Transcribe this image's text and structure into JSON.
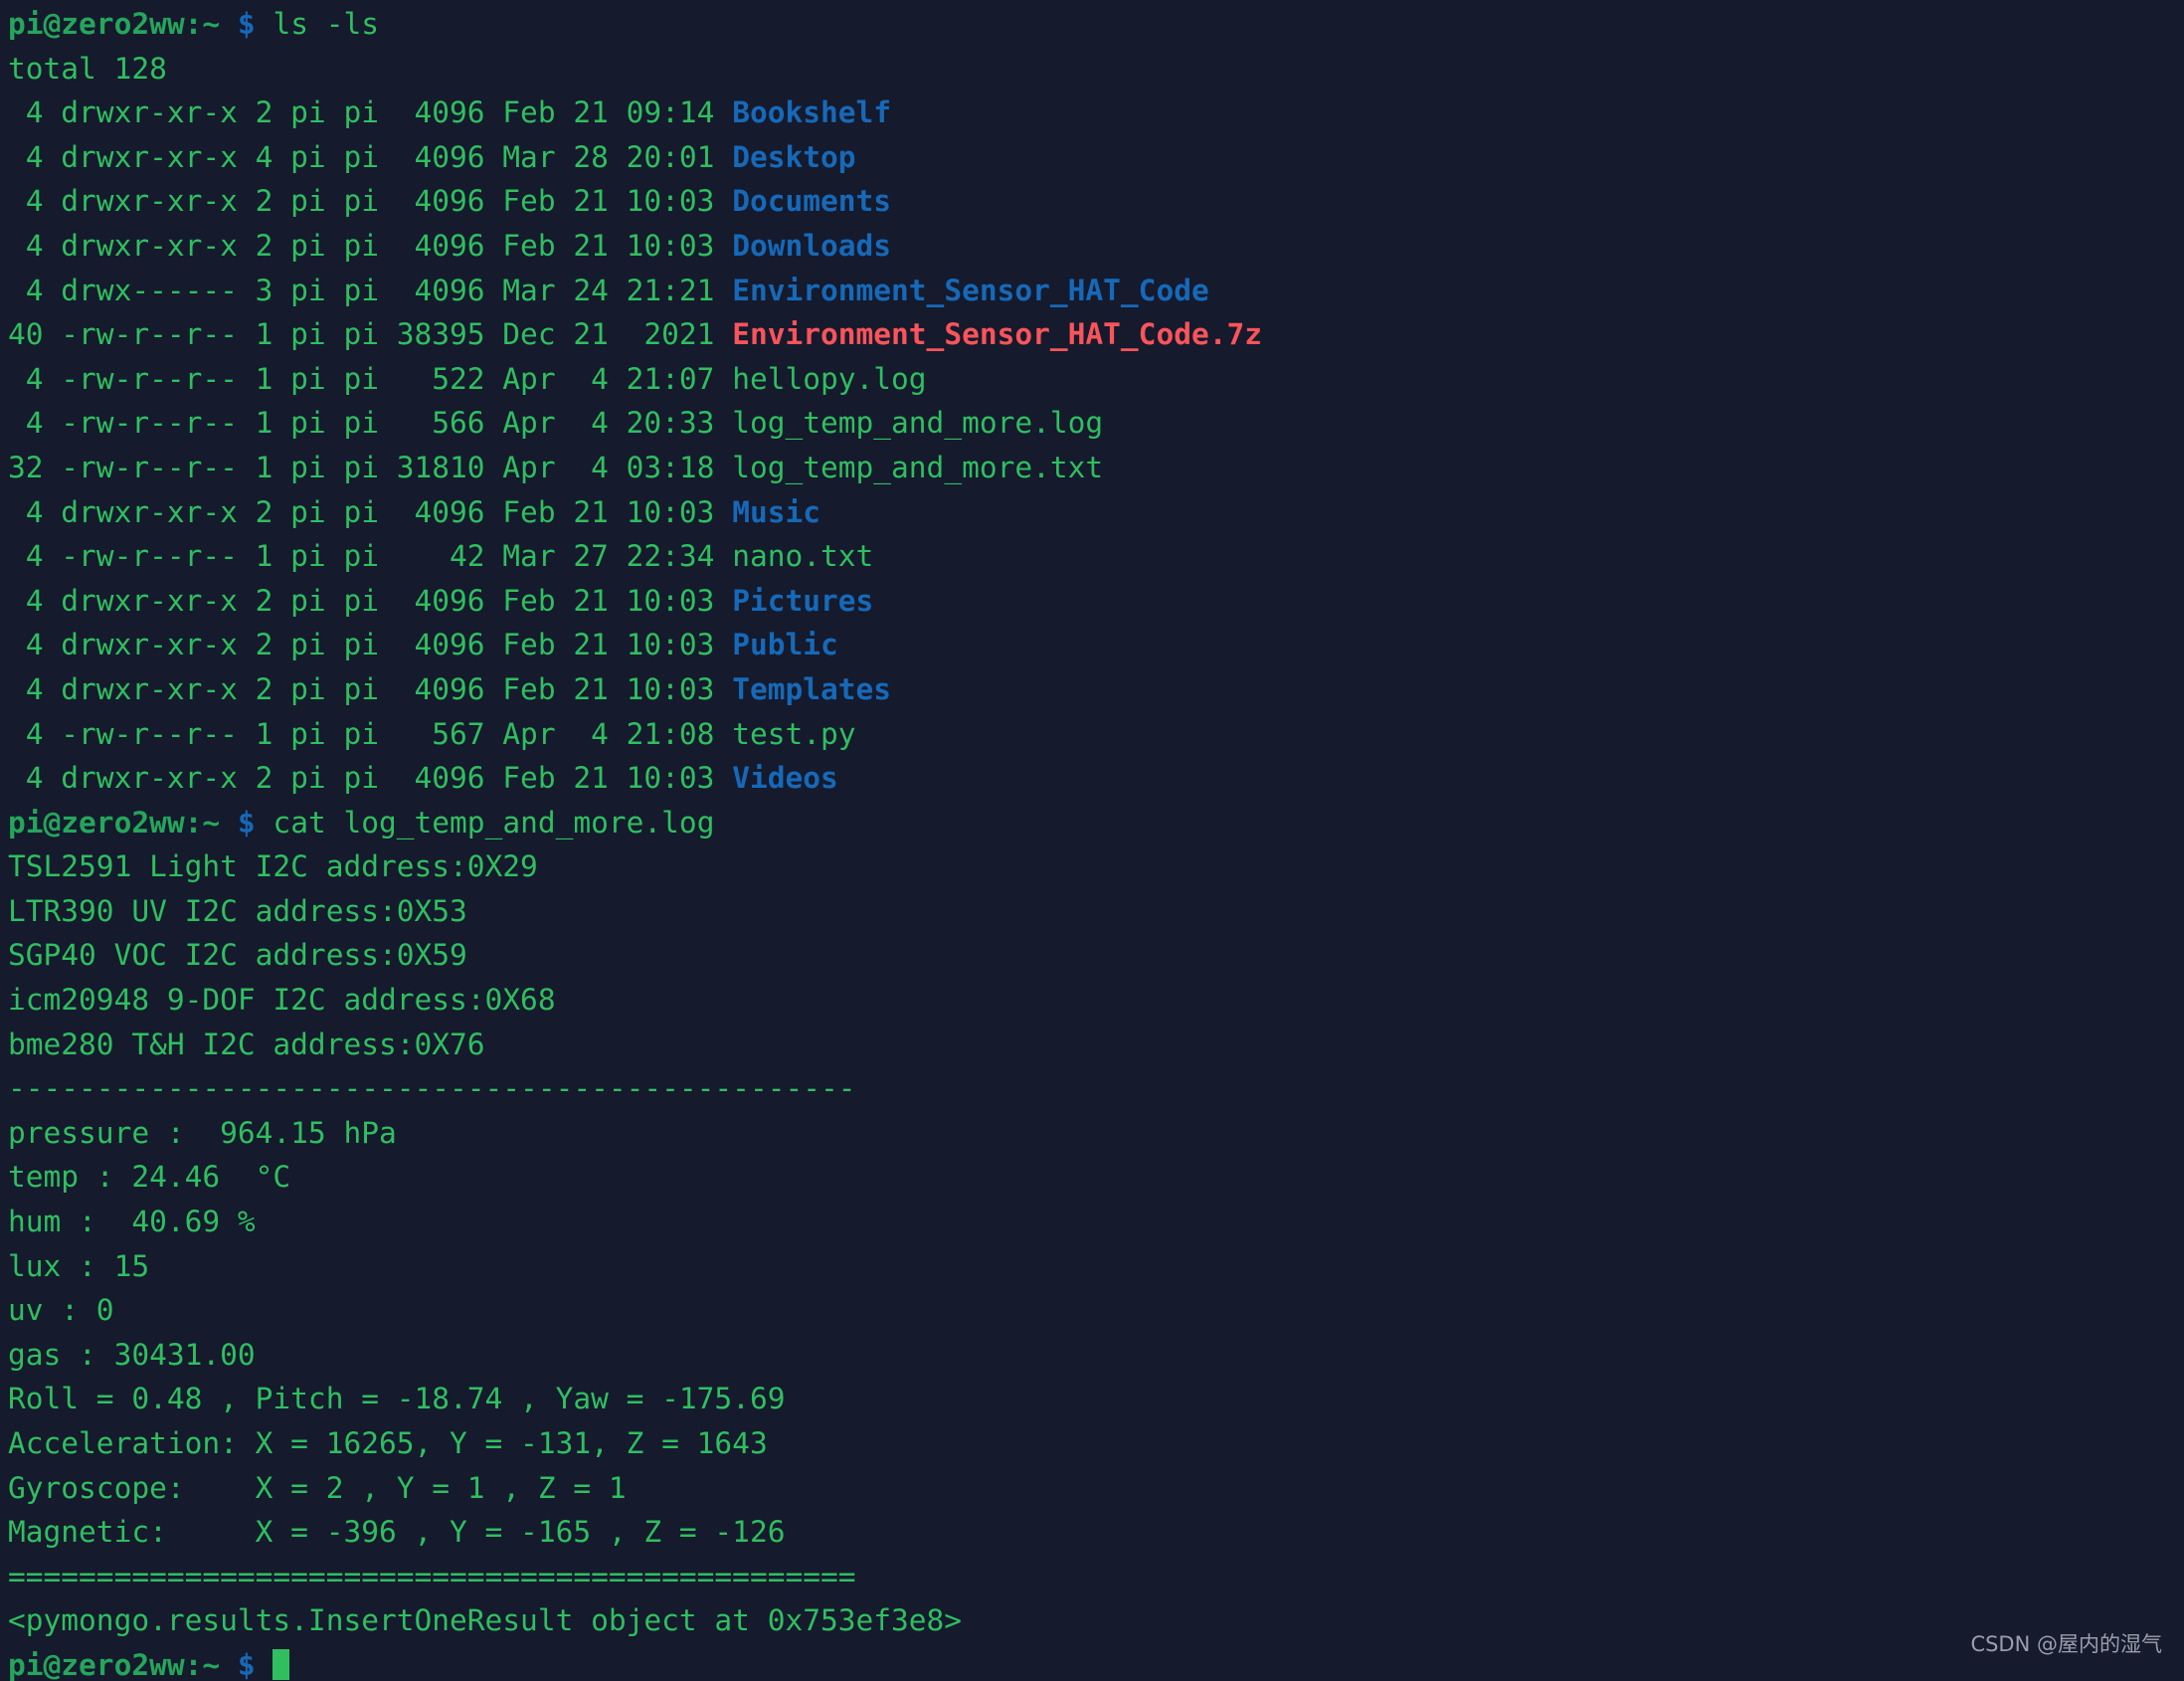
{
  "terminal": {
    "background_color": "#151a2d",
    "text_color": "#2fbf5f",
    "dir_color": "#1669b8",
    "archive_color": "#f9545a",
    "prompt_user_host": "pi@zero2ww:~",
    "prompt_symbol": "$",
    "cursor": ""
  },
  "commands": {
    "first": "ls -ls",
    "second": "cat log_temp_and_more.log"
  },
  "ls_output": {
    "total_line": "total 128",
    "rows": [
      {
        "meta": " 4 drwxr-xr-x 2 pi pi  4096 Feb 21 09:14 ",
        "name": "Bookshelf",
        "kind": "dir"
      },
      {
        "meta": " 4 drwxr-xr-x 4 pi pi  4096 Mar 28 20:01 ",
        "name": "Desktop",
        "kind": "dir"
      },
      {
        "meta": " 4 drwxr-xr-x 2 pi pi  4096 Feb 21 10:03 ",
        "name": "Documents",
        "kind": "dir"
      },
      {
        "meta": " 4 drwxr-xr-x 2 pi pi  4096 Feb 21 10:03 ",
        "name": "Downloads",
        "kind": "dir"
      },
      {
        "meta": " 4 drwx------ 3 pi pi  4096 Mar 24 21:21 ",
        "name": "Environment_Sensor_HAT_Code",
        "kind": "dir"
      },
      {
        "meta": "40 -rw-r--r-- 1 pi pi 38395 Dec 21  2021 ",
        "name": "Environment_Sensor_HAT_Code.7z",
        "kind": "archive"
      },
      {
        "meta": " 4 -rw-r--r-- 1 pi pi   522 Apr  4 21:07 ",
        "name": "hellopy.log",
        "kind": "file"
      },
      {
        "meta": " 4 -rw-r--r-- 1 pi pi   566 Apr  4 20:33 ",
        "name": "log_temp_and_more.log",
        "kind": "file"
      },
      {
        "meta": "32 -rw-r--r-- 1 pi pi 31810 Apr  4 03:18 ",
        "name": "log_temp_and_more.txt",
        "kind": "file"
      },
      {
        "meta": " 4 drwxr-xr-x 2 pi pi  4096 Feb 21 10:03 ",
        "name": "Music",
        "kind": "dir"
      },
      {
        "meta": " 4 -rw-r--r-- 1 pi pi    42 Mar 27 22:34 ",
        "name": "nano.txt",
        "kind": "file"
      },
      {
        "meta": " 4 drwxr-xr-x 2 pi pi  4096 Feb 21 10:03 ",
        "name": "Pictures",
        "kind": "dir"
      },
      {
        "meta": " 4 drwxr-xr-x 2 pi pi  4096 Feb 21 10:03 ",
        "name": "Public",
        "kind": "dir"
      },
      {
        "meta": " 4 drwxr-xr-x 2 pi pi  4096 Feb 21 10:03 ",
        "name": "Templates",
        "kind": "dir"
      },
      {
        "meta": " 4 -rw-r--r-- 1 pi pi   567 Apr  4 21:08 ",
        "name": "test.py",
        "kind": "file"
      },
      {
        "meta": " 4 drwxr-xr-x 2 pi pi  4096 Feb 21 10:03 ",
        "name": "Videos",
        "kind": "dir"
      }
    ]
  },
  "log_output": {
    "sensors": [
      "TSL2591 Light I2C address:0X29",
      "LTR390 UV I2C address:0X53",
      "SGP40 VOC I2C address:0X59",
      "icm20948 9-DOF I2C address:0X68",
      "bme280 T&H I2C address:0X76"
    ],
    "divider_dash": "------------------------------------------------",
    "readings": [
      "pressure :  964.15 hPa",
      "temp : 24.46  °C",
      "hum :  40.69 %",
      "lux : 15",
      "uv : 0",
      "gas : 30431.00",
      "Roll = 0.48 , Pitch = -18.74 , Yaw = -175.69",
      "Acceleration: X = 16265, Y = -131, Z = 1643",
      "Gyroscope:    X = 2 , Y = 1 , Z = 1",
      "Magnetic:     X = -396 , Y = -165 , Z = -126"
    ],
    "divider_equals": "================================================",
    "result": "<pymongo.results.InsertOneResult object at 0x753ef3e8>"
  },
  "watermark": "CSDN @屋内的湿气"
}
